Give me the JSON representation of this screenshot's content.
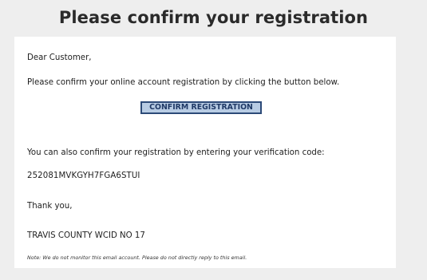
{
  "heading": "Please confirm your registration",
  "email": {
    "greeting": "Dear Customer,",
    "instruction": "Please confirm your online account registration by clicking the button below.",
    "confirm_button": "CONFIRM REGISTRATION",
    "alt_instruction": "You can also confirm your registration by entering your verification code:",
    "verification_code": "252081MVKGYH7FGA6STUI",
    "thanks": "Thank you,",
    "organization": "TRAVIS COUNTY WCID NO 17",
    "note": "Note: We do not monitor this email account. Please do not directly reply to this email."
  },
  "colors": {
    "button_fill": "#b8cce4",
    "button_border": "#2c4a78",
    "card_background": "#ffffff",
    "page_background": "#eeeeee"
  }
}
